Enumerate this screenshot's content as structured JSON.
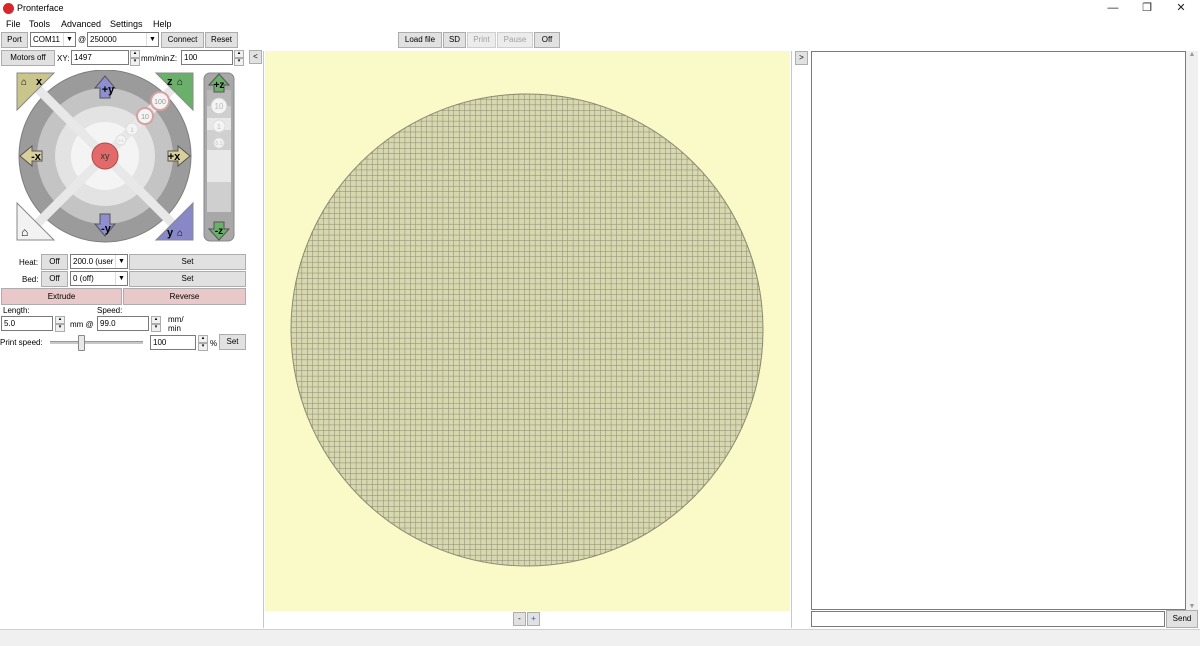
{
  "window": {
    "title": "Pronterface",
    "minimize": "—",
    "restore": "❐",
    "close": "✕"
  },
  "menu": [
    "File",
    "Tools",
    "Advanced",
    "Settings",
    "Help"
  ],
  "toolbar": {
    "port_label": "Port",
    "port_value": "COM11",
    "at": "@",
    "baud_value": "250000",
    "connect": "Connect",
    "reset": "Reset",
    "collapse": "<",
    "load_file": "Load file",
    "sd": "SD",
    "print": "Print",
    "pause": "Pause",
    "off": "Off"
  },
  "motion": {
    "motors_off": "Motors off",
    "xy_label": "XY:",
    "xy_value": "1497",
    "xy_unit": "mm/min",
    "z_label": "Z:",
    "z_value": "100"
  },
  "jog": {
    "home_x": "x",
    "home_z": "z",
    "home_y": "y",
    "plus_y": "+y",
    "minus_y": "-y",
    "plus_x": "+x",
    "minus_x": "-x",
    "ring_100": "100",
    "ring_10": "10",
    "ring_1": "1",
    "ring_01": "0.1",
    "center": "xy",
    "plus_z": "+z",
    "minus_z": "-z",
    "z_10": "10",
    "z_1": "1",
    "z_01": "0.1"
  },
  "temps": {
    "heat_label": "Heat:",
    "heat_off": "Off",
    "heat_value": "200.0 (user",
    "heat_set": "Set",
    "bed_label": "Bed:",
    "bed_off": "Off",
    "bed_value": "0 (off)",
    "bed_set": "Set"
  },
  "extrusion": {
    "extrude": "Extrude",
    "reverse": "Reverse",
    "length_label": "Length:",
    "length_value": "5.0",
    "mm_at": "mm @",
    "speed_label": "Speed:",
    "speed_value": "99.0",
    "speed_unit_1": "mm/",
    "speed_unit_2": "min",
    "print_speed_label": "Print speed:",
    "print_speed_value": "100",
    "percent": "%",
    "set": "Set",
    "print_speed_slider_percent": 33
  },
  "plate": {
    "zoom_minus": "-",
    "zoom_plus": "+",
    "bed_grid_lines": 87
  },
  "console": {
    "send": "Send",
    "expand": ">"
  },
  "colors": {
    "plate_bg": "#fafac8",
    "bed_fill": "#d8d8b0",
    "grid": "#8a8a70",
    "extrude_bg": "#e8c8c8"
  }
}
